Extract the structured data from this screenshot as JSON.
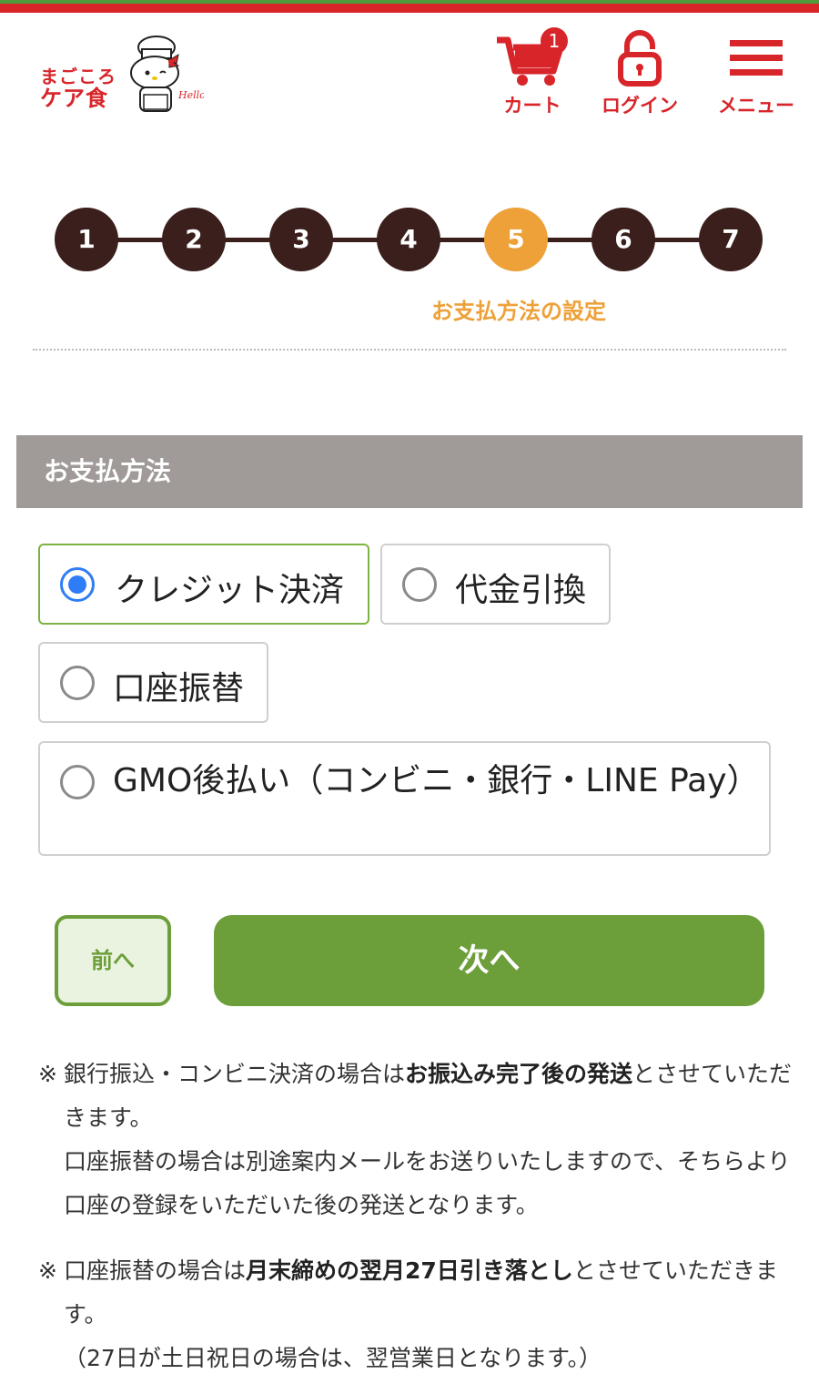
{
  "header": {
    "logo_line1": "まごころ",
    "logo_line2": "ケア食",
    "logo_kitty_text": "Hello Kitty",
    "cart_label": "カート",
    "cart_count": "1",
    "login_label": "ログイン",
    "menu_label": "メニュー"
  },
  "steps": {
    "items": [
      "1",
      "2",
      "3",
      "4",
      "5",
      "6",
      "7"
    ],
    "active_index": 4,
    "active_caption": "お支払方法の設定"
  },
  "payment": {
    "section_title": "お支払方法",
    "options": [
      {
        "label": "クレジット決済",
        "selected": true
      },
      {
        "label": "代金引換",
        "selected": false
      },
      {
        "label": "口座振替",
        "selected": false
      },
      {
        "label": "GMO後払い（コンビニ・銀行・LINE Pay）",
        "selected": false
      }
    ]
  },
  "buttons": {
    "prev": "前へ",
    "next": "次へ"
  },
  "notes": {
    "mark": "※",
    "n1_a": "銀行振込・コンビニ決済の場合は",
    "n1_b": "お振込み完了後の発送",
    "n1_c": "とさせていただきます。",
    "n1_d": "口座振替の場合は別途案内メールをお送りいたしますので、そちらより口座の登録をいただいた後の発送となります。",
    "n2_a": "口座振替の場合は",
    "n2_b": "月末締めの翌月27日引き落とし",
    "n2_c": "とさせていただきます。",
    "n2_d": "（27日が土日祝日の場合は、翌営業日となります。）"
  },
  "colors": {
    "brand_red": "#d8252a",
    "step_dark": "#3a1f1c",
    "step_active": "#eda138",
    "green": "#6c9e3a",
    "radio_blue": "#2f7df6"
  }
}
